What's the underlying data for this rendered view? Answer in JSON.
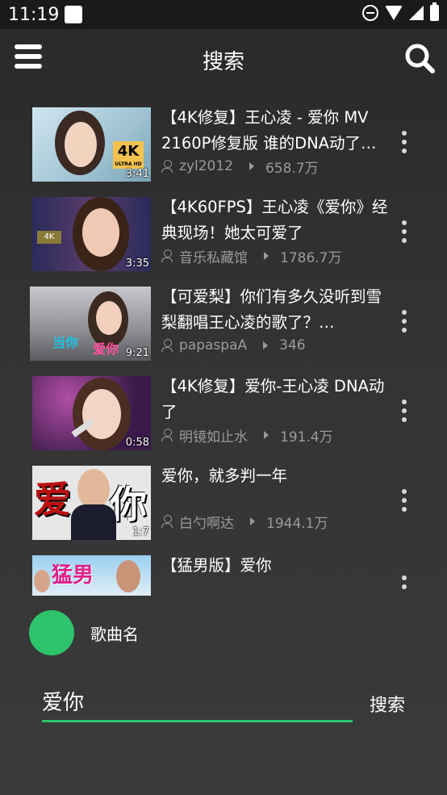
{
  "status_bar": {
    "time": "11:19"
  },
  "app_bar": {
    "title": "搜索"
  },
  "results": [
    {
      "title": "【4K修复】王心凌 - 爱你 MV 2160P修复版 谁的DNA动了…",
      "duration": "3:41",
      "uploader": "zyl2012",
      "views": "658.7万",
      "badge": "4K"
    },
    {
      "title": "【4K60FPS】王心凌《爱你》经典现场！她太可爱了",
      "duration": "3:35",
      "uploader": "音乐私藏馆",
      "views": "1786.7万"
    },
    {
      "title": "【可爱梨】你们有多久没听到雪梨翻唱王心凌的歌了？…",
      "duration": "9:21",
      "uploader": "papaspaA",
      "views": "346",
      "overlay": [
        "当你",
        "爱你"
      ]
    },
    {
      "title": "【4K修复】爱你-王心凌 DNA动了",
      "duration": "0:58",
      "uploader": "明镜如止水",
      "views": "191.4万"
    },
    {
      "title": "爱你，就多判一年",
      "duration": "1:7",
      "uploader": "白勺啊达",
      "views": "1944.1万",
      "overlay": [
        "爱",
        "你"
      ]
    },
    {
      "title": "【猛男版】爱你",
      "duration": "",
      "uploader": "",
      "views": "",
      "overlay": [
        "猛男"
      ]
    }
  ],
  "player": {
    "song_name": "歌曲名"
  },
  "search": {
    "value": "爱你",
    "button": "搜索"
  },
  "colors": {
    "accent": "#2ec46b",
    "background": "#2b2b2b",
    "meta_text": "#9a9a9a"
  }
}
